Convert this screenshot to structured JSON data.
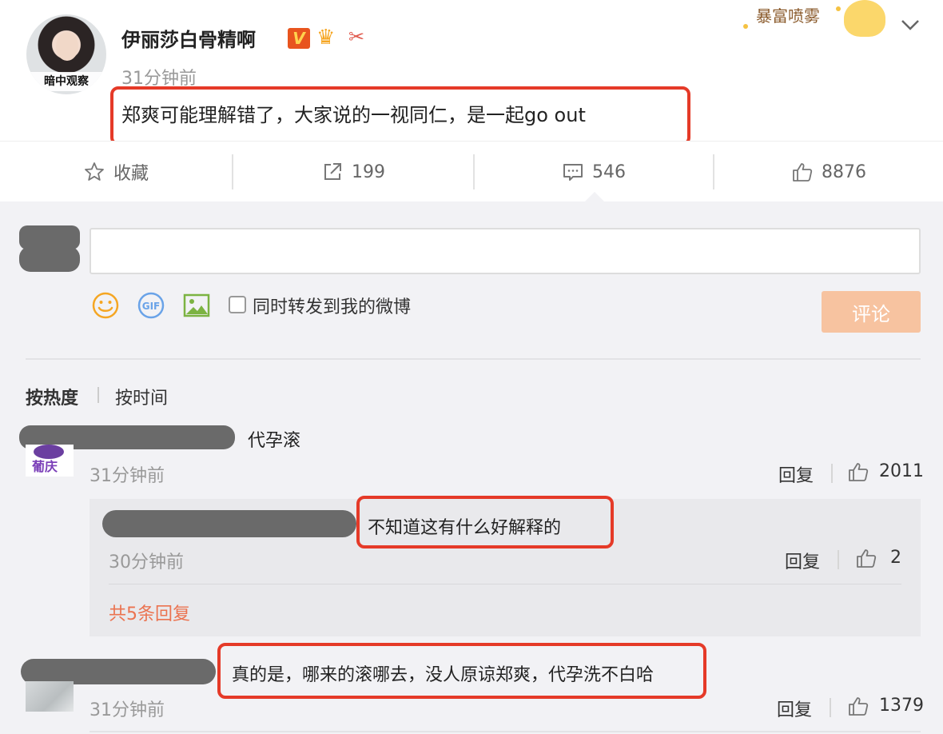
{
  "post": {
    "avatar_label": "暗中观察",
    "username": "伊丽莎白骨精啊",
    "badge_v": "V",
    "time": "31分钟前",
    "text": "郑爽可能理解错了，大家说的一视同仁，是一起go out",
    "sticker_text": "暴富喷雾"
  },
  "actions": {
    "favorite_label": "收藏",
    "repost_count": "199",
    "comment_count": "546",
    "like_count": "8876"
  },
  "compose": {
    "input_value": "",
    "repost_label": "同时转发到我的微博",
    "submit_label": "评论"
  },
  "sort": {
    "hot": "按热度",
    "time": "按时间"
  },
  "comments": [
    {
      "avatar_label": "葡庆",
      "text": "代孕滚",
      "time": "31分钟前",
      "reply_label": "回复",
      "likes": "2011",
      "sub_reply": {
        "text": "不知道这有什么好解释的",
        "time": "30分钟前",
        "reply_label": "回复",
        "likes": "2"
      },
      "more_replies": "共5条回复"
    },
    {
      "text": "真的是，哪来的滚哪去，没人原谅郑爽，代孕洗不白哈",
      "time": "31分钟前",
      "reply_label": "回复",
      "likes": "1379"
    }
  ],
  "colors": {
    "highlight_border": "#e53a28",
    "submit_disabled": "#f7c3a0",
    "link_orange": "#eb7350",
    "redaction_gray": "#6a6a6a"
  }
}
